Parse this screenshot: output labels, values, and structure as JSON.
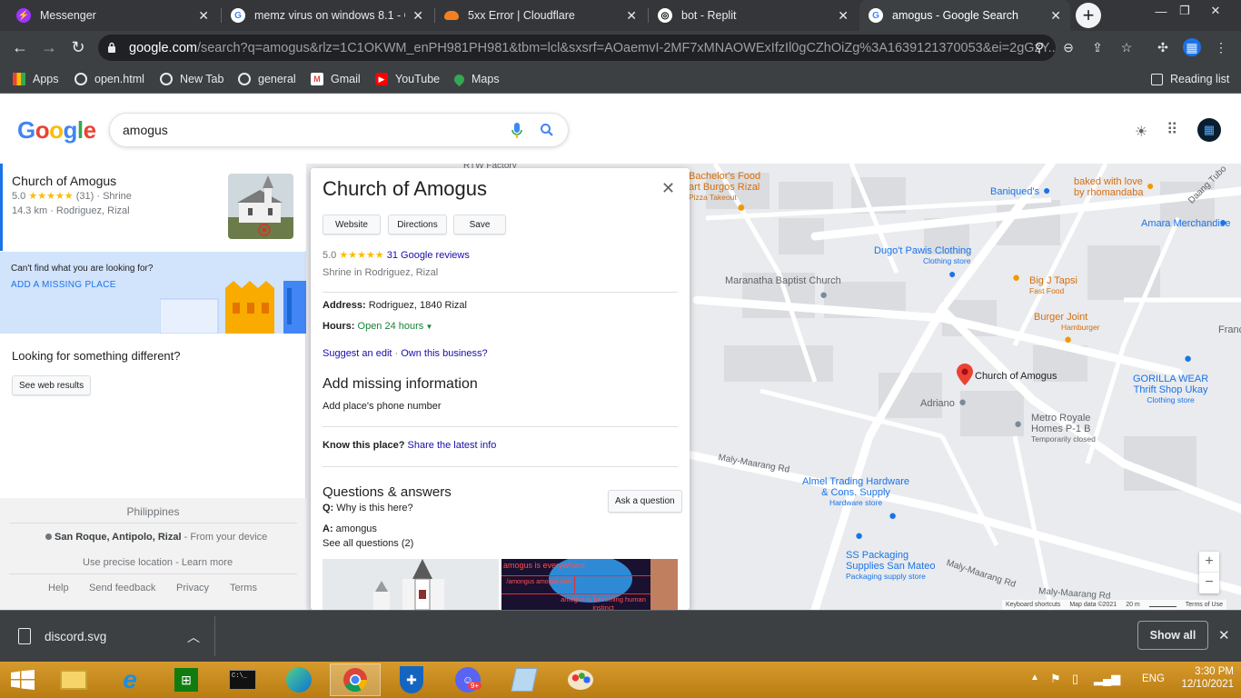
{
  "tabs": [
    {
      "title": "Messenger",
      "color": "#a033ff"
    },
    {
      "title": "memz virus on windows 8.1 - Go",
      "color": "#ffffff"
    },
    {
      "title": "5xx Error | Cloudflare",
      "color": "#f38020"
    },
    {
      "title": "bot - Replit",
      "color": "#ffffff"
    },
    {
      "title": "amogus - Google Search",
      "color": "#ffffff"
    }
  ],
  "omnibox": {
    "host": "google.com",
    "path": "/search?q=amogus&rlz=1C1OKWM_enPH981PH981&tbm=lcl&sxsrf=AOaemvI-2MF7xMNAOWExIfzIl0gCZhOiZg%3A1639121370053&ei=2gGzY..."
  },
  "bookmarks": [
    {
      "label": "Apps",
      "icon": "apps-grid-icon"
    },
    {
      "label": "open.html",
      "icon": "globe-icon"
    },
    {
      "label": "New Tab",
      "icon": "globe-icon"
    },
    {
      "label": "general",
      "icon": "globe-icon"
    },
    {
      "label": "Gmail",
      "icon": "gmail-icon"
    },
    {
      "label": "YouTube",
      "icon": "youtube-icon"
    },
    {
      "label": "Maps",
      "icon": "maps-icon"
    }
  ],
  "reading_list": "Reading list",
  "google": {
    "logo": [
      "G",
      "o",
      "o",
      "g",
      "l",
      "e"
    ],
    "logo_colors": [
      "#4285f4",
      "#ea4335",
      "#fbbc05",
      "#4285f4",
      "#34a853",
      "#ea4335"
    ],
    "query": "amogus"
  },
  "result": {
    "name": "Church of Amogus",
    "rating": "5.0",
    "stars": "★★★★★",
    "count": "(31)",
    "type": "· Shrine",
    "distance": "14.3 km · Rodriguez, Rizal"
  },
  "missing": {
    "prompt": "Can't find what you are looking for?",
    "link": "ADD A MISSING PLACE"
  },
  "different": {
    "heading": "Looking for something different?",
    "button": "See web results"
  },
  "footer": {
    "country": "Philippines",
    "location": "San Roque, Antipolo, Rizal",
    "location_suffix": " - From your device",
    "precise": "Use precise location - Learn more",
    "links": [
      "Help",
      "Send feedback",
      "Privacy",
      "Terms"
    ]
  },
  "card": {
    "title": "Church of Amogus",
    "buttons": [
      "Website",
      "Directions",
      "Save"
    ],
    "rating": "5.0",
    "stars": "★★★★★",
    "reviews": "31 Google reviews",
    "category": "Shrine in Rodriguez, Rizal",
    "address_label": "Address:",
    "address": "Rodriguez, 1840 Rizal",
    "hours_label": "Hours:",
    "hours": "Open 24 hours",
    "suggest": "Suggest an edit",
    "own": "Own this business?",
    "missing_heading": "Add missing information",
    "add_phone": "Add place's phone number",
    "know_label": "Know this place?",
    "share": "Share the latest info",
    "qa_heading": "Questions & answers",
    "ask_button": "Ask a question",
    "q_label": "Q:",
    "question": "Why is this here?",
    "a_label": "A:",
    "answer": "amongus",
    "see_all": "See all questions (2)",
    "meme_line1": "amogus is everywhere",
    "meme_line2": "/amongus amogus ban",
    "meme_line3": "amogus is becoming human instinct"
  },
  "map": {
    "labels": {
      "rtw": "RTW Factory",
      "bachelor": "Bachelor's Food",
      "bachelor2": "art Burgos Rizal",
      "bachelor_sub": "Pizza Takeout",
      "baniqued": "Baniqued's",
      "baked": "baked with love",
      "baked2": "by rhomandaba",
      "daang": "Daang Tubo",
      "amara": "Amara Merchandise",
      "dugo": "Dugo't Pawis Clothing",
      "dugo_sub": "Clothing store",
      "maranatha": "Maranatha Baptist Church",
      "bigj": "Big J Tapsi",
      "bigj_sub": "Fast Food",
      "burger": "Burger Joint",
      "burger_sub": "Hamburger",
      "franc": "Franc",
      "church": "Church of Amogus",
      "adriano": "Adriano",
      "gorilla": "GORILLA WEAR",
      "gorilla2": "Thrift Shop Ukay",
      "gorilla_sub": "Clothing store",
      "metro": "Metro Royale",
      "metro2": "Homes P-1 B",
      "metro_sub": "Temporarily closed",
      "maly1": "Maly-Maarang Rd",
      "almel": "Almel Trading Hardware",
      "almel2": "& Cons. Supply",
      "almel_sub": "Hardware store",
      "ss": "SS Packaging",
      "ss2": "Supplies San Mateo",
      "ss_sub": "Packaging supply store",
      "maly2": "Maly-Maarang Rd",
      "maly3": "Maly-Maarang Rd"
    },
    "attribution": [
      "Keyboard shortcuts",
      "Map data ©2021",
      "20 m",
      "Terms of Use"
    ],
    "zoom_in": "+",
    "zoom_out": "−"
  },
  "download": {
    "file": "discord.svg",
    "show_all": "Show all"
  },
  "taskbar": {
    "lang": "ENG",
    "time": "3:30 PM",
    "date": "12/10/2021",
    "discord_badge": "9+"
  }
}
